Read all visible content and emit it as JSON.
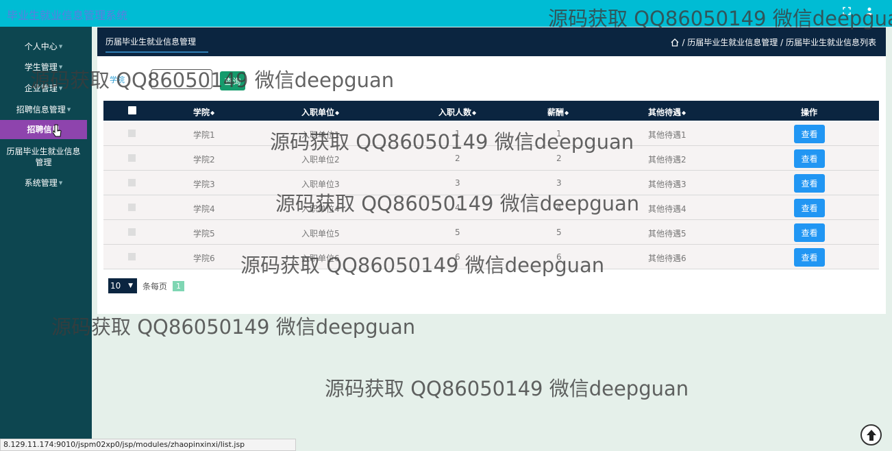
{
  "app": {
    "title": "毕业生就业信息管理系统"
  },
  "sidebar": {
    "items": [
      {
        "label": "个人中心",
        "has_caret": true
      },
      {
        "label": "学生管理",
        "has_caret": true
      },
      {
        "label": "企业管理",
        "has_caret": true
      },
      {
        "label": "招聘信息管理",
        "has_caret": true
      },
      {
        "label": "招聘信息",
        "has_caret": false,
        "active": true
      },
      {
        "label": "历届毕业生就业信息管理",
        "has_caret": false
      },
      {
        "label": "系统管理",
        "has_caret": true
      }
    ]
  },
  "header": {
    "title": "历届毕业生就业信息管理",
    "breadcrumb": "/ 历届毕业生就业信息管理 / 历届毕业生就业信息列表"
  },
  "search": {
    "label": "学院",
    "value": "",
    "button": "查询"
  },
  "table": {
    "columns": [
      "学院",
      "入职单位",
      "入职人数",
      "薪酬",
      "其他待遇",
      "操作"
    ],
    "rows": [
      {
        "college": "学院1",
        "employer": "入职单位1",
        "count": "1",
        "salary": "1",
        "benefits": "其他待遇1",
        "action": "查看"
      },
      {
        "college": "学院2",
        "employer": "入职单位2",
        "count": "2",
        "salary": "2",
        "benefits": "其他待遇2",
        "action": "查看"
      },
      {
        "college": "学院3",
        "employer": "入职单位3",
        "count": "3",
        "salary": "3",
        "benefits": "其他待遇3",
        "action": "查看"
      },
      {
        "college": "学院4",
        "employer": "入职单位4",
        "count": "4",
        "salary": "4",
        "benefits": "其他待遇4",
        "action": "查看"
      },
      {
        "college": "学院5",
        "employer": "入职单位5",
        "count": "5",
        "salary": "5",
        "benefits": "其他待遇5",
        "action": "查看"
      },
      {
        "college": "学院6",
        "employer": "入职单位6",
        "count": "6",
        "salary": "6",
        "benefits": "其他待遇6",
        "action": "查看"
      }
    ]
  },
  "pagination": {
    "page_size": "10",
    "per_page_label": "条每页",
    "current_page": "1"
  },
  "status_bar": {
    "url": "8.129.11.174:9010/jspm02xp0/jsp/modules/zhaopinxinxi/list.jsp"
  },
  "watermark": {
    "text": "源码获取 QQ86050149 微信deepguan"
  },
  "colors": {
    "topbar": "#00bcd4",
    "sidebar": "#0d4650",
    "active": "#8e44ad",
    "header": "#0b2540",
    "search_button": "#159b6c",
    "view_button": "#2196f3"
  },
  "icons": [
    "fullscreen-icon",
    "user-icon",
    "home-icon",
    "cursor-icon",
    "back-to-top-icon",
    "sort-icon"
  ]
}
